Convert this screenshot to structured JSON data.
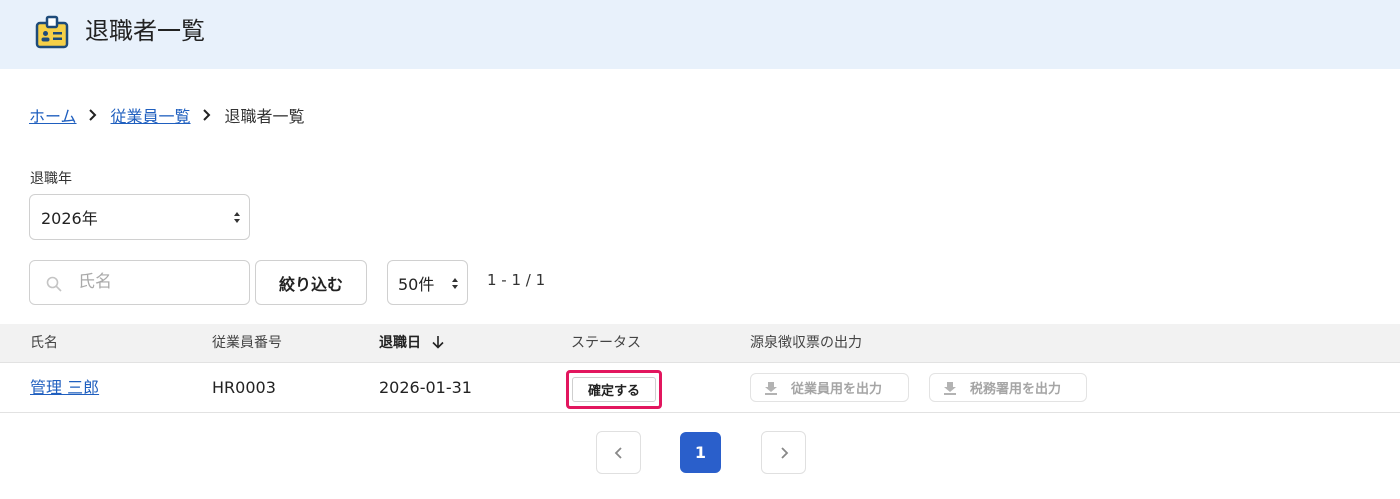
{
  "header": {
    "title": "退職者一覧",
    "icon": "id-badge-icon"
  },
  "breadcrumb": {
    "items": [
      "ホーム",
      "従業員一覧"
    ],
    "current": "退職者一覧"
  },
  "filters": {
    "year_label": "退職年",
    "year_value": "2026年",
    "search_placeholder": "氏名",
    "filter_button": "絞り込む",
    "per_page": "50件",
    "range": "1 - 1 / 1"
  },
  "table": {
    "headers": [
      "氏名",
      "従業員番号",
      "退職日",
      "ステータス",
      "源泉徴収票の出力"
    ],
    "sorted_column": "退職日",
    "rows": [
      {
        "name": "管理 三郎",
        "employee_number": "HR0003",
        "retirement_date": "2026-01-31",
        "status_button": "確定する",
        "export_employee": "従業員用を出力",
        "export_tax": "税務署用を出力"
      }
    ]
  },
  "pagination": {
    "current": "1"
  },
  "colors": {
    "header_bg": "#e8f1fb",
    "link": "#1f5fbf",
    "highlight": "#e2165e",
    "page_active": "#2a5fcb",
    "disabled_text": "#a5a5a5"
  }
}
